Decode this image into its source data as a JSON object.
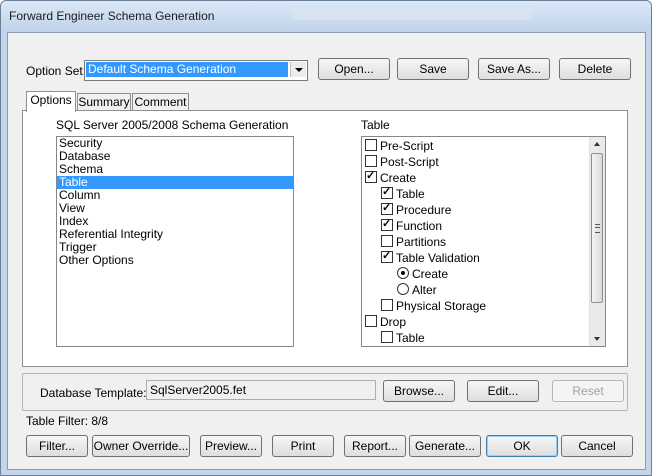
{
  "window": {
    "title": "Forward Engineer Schema Generation"
  },
  "option_set": {
    "label": "Option Set:",
    "value": "Default Schema Generation"
  },
  "top_buttons": {
    "open": "Open...",
    "save": "Save",
    "save_as": "Save As...",
    "delete": "Delete"
  },
  "tabs": [
    {
      "label": "Options"
    },
    {
      "label": "Summary"
    },
    {
      "label": "Comment"
    }
  ],
  "left_panel": {
    "heading": "SQL Server 2005/2008 Schema Generation",
    "items": [
      "Security",
      "Database",
      "Schema",
      "Table",
      "Column",
      "View",
      "Index",
      "Referential Integrity",
      "Trigger",
      "Other Options"
    ],
    "selected": "Table"
  },
  "right_panel": {
    "heading": "Table",
    "rows": [
      {
        "label": "Pre-Script",
        "type": "checkbox",
        "checked": false,
        "level": 0
      },
      {
        "label": "Post-Script",
        "type": "checkbox",
        "checked": false,
        "level": 0
      },
      {
        "label": "Create",
        "type": "checkbox",
        "checked": true,
        "level": 0
      },
      {
        "label": "Table",
        "type": "checkbox",
        "checked": true,
        "level": 1
      },
      {
        "label": "Procedure",
        "type": "checkbox",
        "checked": true,
        "level": 1
      },
      {
        "label": "Function",
        "type": "checkbox",
        "checked": true,
        "level": 1
      },
      {
        "label": "Partitions",
        "type": "checkbox",
        "checked": false,
        "level": 1
      },
      {
        "label": "Table Validation",
        "type": "checkbox",
        "checked": true,
        "level": 1
      },
      {
        "label": "Create",
        "type": "radio",
        "checked": true,
        "level": 2
      },
      {
        "label": "Alter",
        "type": "radio",
        "checked": false,
        "level": 2
      },
      {
        "label": "Physical Storage",
        "type": "checkbox",
        "checked": false,
        "level": 1
      },
      {
        "label": "Drop",
        "type": "checkbox",
        "checked": false,
        "level": 0
      },
      {
        "label": "Table",
        "type": "checkbox",
        "checked": false,
        "level": 1
      }
    ]
  },
  "database_template": {
    "label": "Database Template:",
    "value": "SqlServer2005.fet",
    "browse": "Browse...",
    "edit": "Edit...",
    "reset": "Reset"
  },
  "table_filter": "Table Filter: 8/8",
  "bottom_buttons": {
    "filter": "Filter...",
    "owner_override": "Owner Override...",
    "preview": "Preview...",
    "print": "Print",
    "report": "Report...",
    "generate": "Generate...",
    "ok": "OK",
    "cancel": "Cancel"
  },
  "colors": {
    "selection": "#3399ff",
    "title_bar": "#c4d6ec",
    "dialog_bg": "#f0f0f0"
  }
}
